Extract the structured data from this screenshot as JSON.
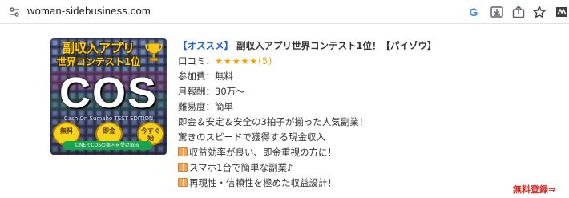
{
  "browser": {
    "url": "woman-sidebusiness.com",
    "toolbar_icons": [
      "google-icon",
      "install-icon",
      "share-icon",
      "bookmark-star-icon",
      "extension-icon"
    ]
  },
  "listing": {
    "banner": {
      "title_line1": "副収入アプリ",
      "title_line2": "世界コンテスト1位",
      "logo_text": "COS",
      "sub_text": "Cash On Sumaho TEST EDITION",
      "coins": [
        "無料",
        "即金",
        "今すぐ始"
      ],
      "line_button": "LINEでCOSの案内を受け取る"
    },
    "tag": "【オススメ】",
    "title": "副収入アプリ世界コンテスト1位！【パイゾウ】",
    "review_label": "口コミ：",
    "review_stars": "★★★★★",
    "review_count": "(5)",
    "fee": "参加費：無料",
    "monthly": "月報酬：30万〜",
    "difficulty": "難易度：簡単",
    "description_lines": [
      "即金＆安定＆安全の3拍子が揃った人気副業！",
      "驚きのスピードで獲得する現金収入"
    ],
    "bullets": [
      "収益効率が良い、即金重視の方に！",
      "スマホ1台で簡単な副業♪",
      "再現性・信頼性を極めた収益設計！"
    ],
    "register_link": "無料登録⇒"
  },
  "colors": {
    "tag": "#2563c9",
    "stars": "#f0a600",
    "register": "#e0241b",
    "banner_title": "#ffd21a"
  }
}
